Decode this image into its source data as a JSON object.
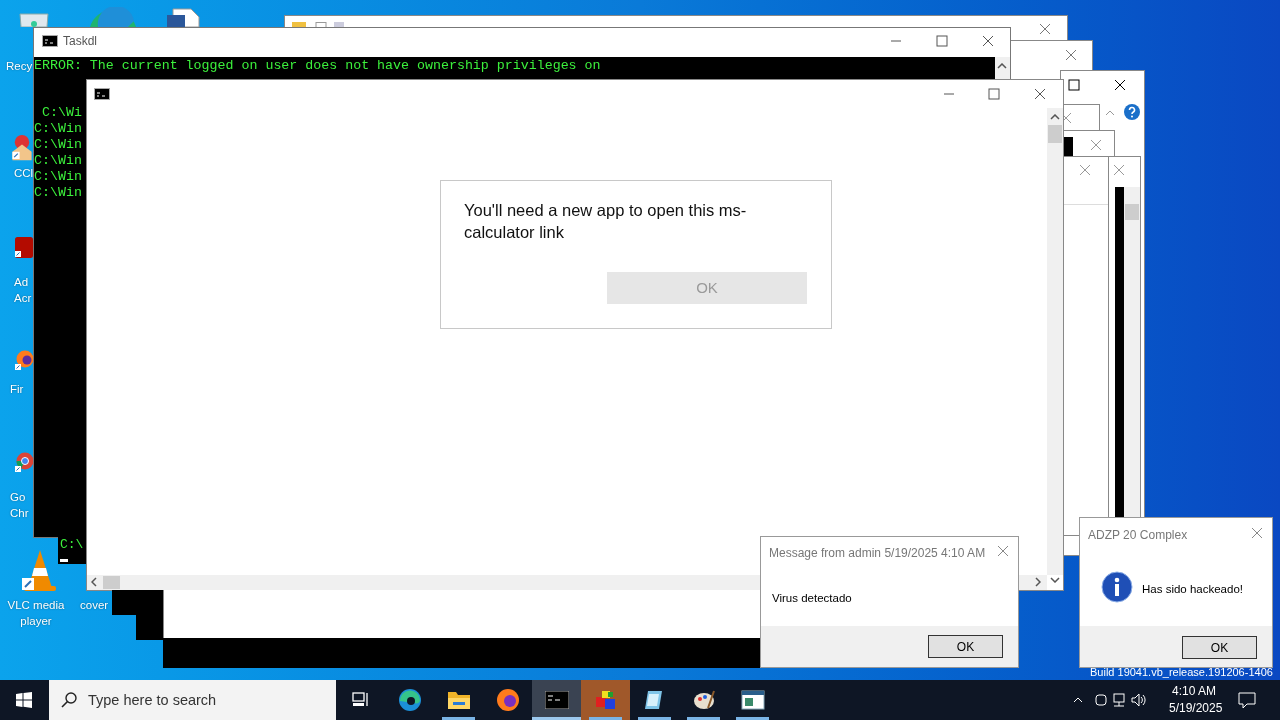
{
  "desktop_icons": [
    {
      "kind": "recycle",
      "lines": [
        "Recy"
      ]
    },
    {
      "kind": "ccleaner",
      "lines": [
        "CCl"
      ]
    },
    {
      "kind": "acrobat",
      "lines": [
        "Ad",
        "Acr"
      ]
    },
    {
      "kind": "firefox",
      "lines": [
        "Fir"
      ]
    },
    {
      "kind": "chrome",
      "lines": [
        "Go",
        "Chr"
      ]
    },
    {
      "kind": "vlc",
      "lines": [
        "VLC media",
        "player"
      ]
    },
    {
      "kind": "file",
      "lines": [
        "cover"
      ]
    }
  ],
  "console_window": {
    "title": "Taskdl",
    "lines": [
      "ERROR: The current logged on user does not have ownership privileges on",
      " C:\\Wi",
      "C:\\Win",
      "C:\\Win",
      "C:\\Win",
      "C:\\Win",
      "C:\\Win"
    ]
  },
  "small_console": {
    "lines": [
      "C:\\"
    ]
  },
  "app_prompt": {
    "message": "You'll need a new app to open this ms-calculator link",
    "button": {
      "label": "OK",
      "disabled": true
    }
  },
  "message_dialog": {
    "title": "Message from admin 5/19/2025 4:10 AM",
    "message": "Virus detectado",
    "button": "OK"
  },
  "info_dialog": {
    "title": "ADZP 20 Complex",
    "message": "Has sido hackeado!",
    "button": "OK"
  },
  "build_text": "Build 19041.vb_release.191206-1406",
  "taskbar": {
    "search": {
      "placeholder": "Type here to search"
    },
    "apps": [
      {
        "kind": "taskview",
        "running": false,
        "selected": false,
        "flashing": false
      },
      {
        "kind": "edge",
        "running": false,
        "selected": false,
        "flashing": false
      },
      {
        "kind": "explorer",
        "running": true,
        "selected": false,
        "flashing": false
      },
      {
        "kind": "firefox",
        "running": false,
        "selected": false,
        "flashing": false
      },
      {
        "kind": "cmd",
        "running": true,
        "selected": true,
        "flashing": false
      },
      {
        "kind": "boxes",
        "running": true,
        "selected": false,
        "flashing": true
      },
      {
        "kind": "notepad",
        "running": true,
        "selected": false,
        "flashing": false
      },
      {
        "kind": "paint",
        "running": true,
        "selected": false,
        "flashing": false
      },
      {
        "kind": "window",
        "running": true,
        "selected": false,
        "flashing": false
      }
    ],
    "time": "4:10 AM",
    "date": "5/19/2025"
  }
}
